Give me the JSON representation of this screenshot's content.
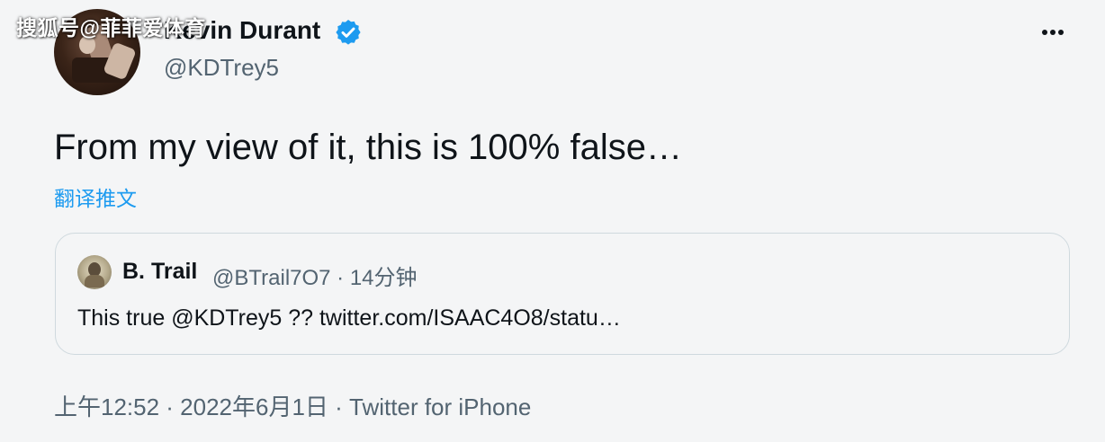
{
  "watermark": "搜狐号@菲菲爱体育",
  "author": {
    "display_name": "Kevin Durant",
    "handle": "@KDTrey5",
    "verified_color": "#1d9bf0"
  },
  "tweet": {
    "text": "From my view of it, this is 100% false…",
    "translate_label": "翻译推文",
    "timestamp": "上午12:52 · 2022年6月1日 · Twitter for iPhone"
  },
  "quoted_tweet": {
    "display_name": "B. Trail",
    "meta": "@BTrail7O7 · 14分钟",
    "text": "This true @KDTrey5 ?? twitter.com/ISAAC4O8/statu…"
  },
  "icons": {
    "verified": "verified-badge-icon",
    "more": "more-options-icon"
  }
}
